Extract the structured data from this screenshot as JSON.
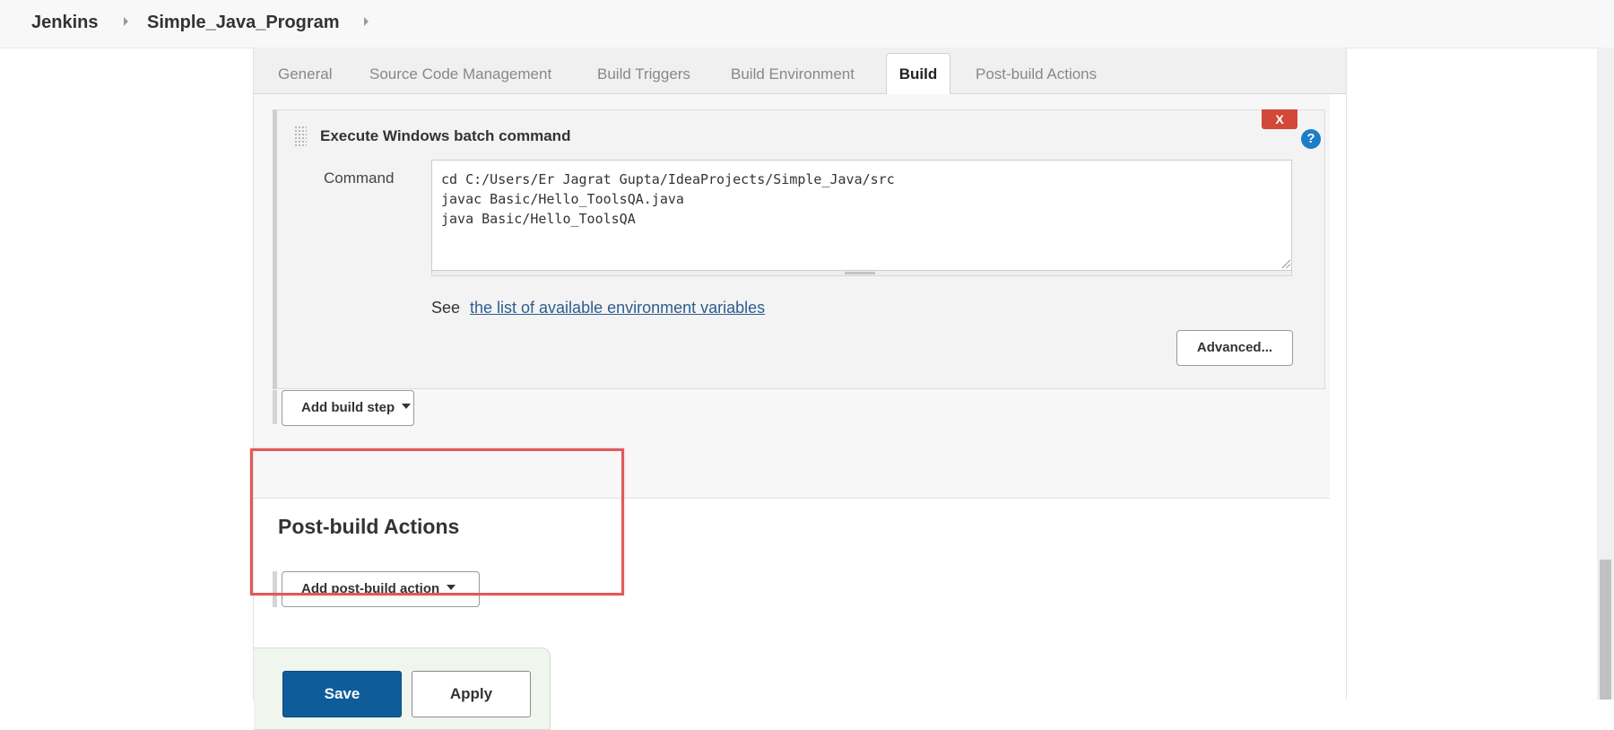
{
  "breadcrumb": {
    "items": [
      "Jenkins",
      "Simple_Java_Program"
    ]
  },
  "tabs": {
    "items": [
      "General",
      "Source Code Management",
      "Build Triggers",
      "Build Environment",
      "Build",
      "Post-build Actions"
    ],
    "active": "Build"
  },
  "build_step": {
    "title": "Execute Windows batch command",
    "delete_label": "X",
    "help_label": "?",
    "command_label": "Command",
    "command_value": "cd C:/Users/Er Jagrat Gupta/IdeaProjects/Simple_Java/src\njavac Basic/Hello_ToolsQA.java\njava Basic/Hello_ToolsQA",
    "env_prefix": "See",
    "env_link": "the list of available environment variables",
    "advanced_label": "Advanced..."
  },
  "add_build_step_label": "Add build step",
  "post_build": {
    "title": "Post-build Actions",
    "add_label": "Add post-build action"
  },
  "footer": {
    "save_label": "Save",
    "apply_label": "Apply"
  },
  "colors": {
    "primary_button": "#0f5c9a",
    "delete_button": "#d24939",
    "help_icon": "#1d7dc6",
    "link": "#2e5d8e",
    "highlight_box": "#e05a5a"
  }
}
